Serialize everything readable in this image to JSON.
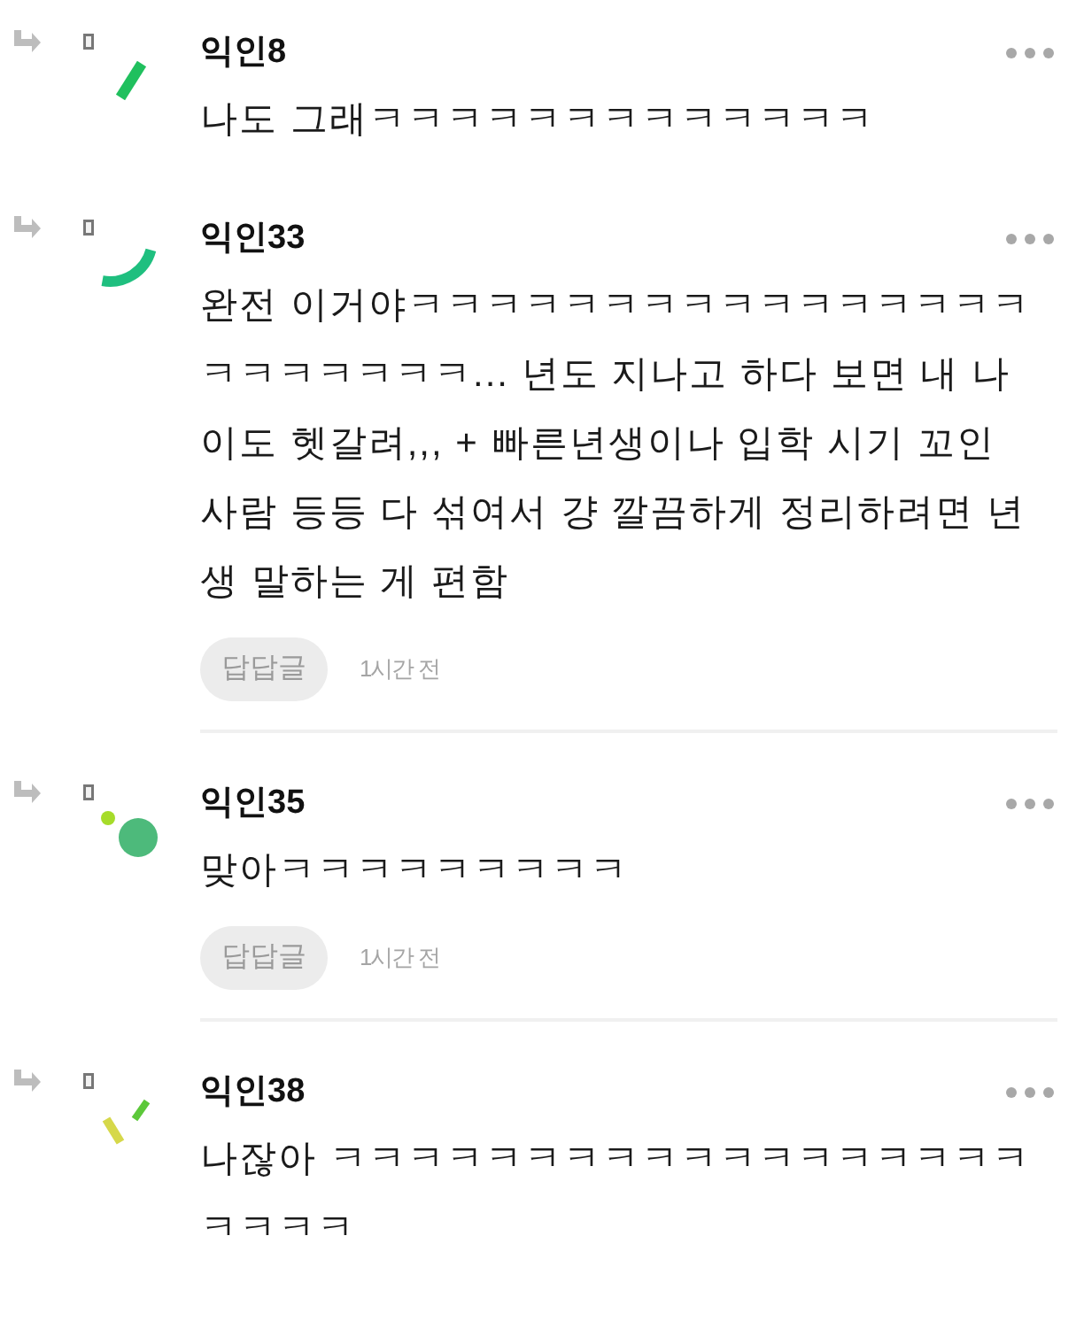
{
  "comments": [
    {
      "author": "익인8",
      "text": "나도 그래ㅋㅋㅋㅋㅋㅋㅋㅋㅋㅋㅋㅋㅋ",
      "avatar": {
        "kind": "bar"
      }
    },
    {
      "author": "익인33",
      "text": "완전 이거야ㅋㅋㅋㅋㅋㅋㅋㅋㅋㅋㅋㅋㅋㅋㅋㅋㅋㅋㅋㅋㅋㅋㅋ... 년도 지나고 하다 보면 내 나이도 헷갈려,,, + 빠른년생이나 입학 시기 꼬인 사람 등등 다 섞여서 걍 깔끔하게 정리하려면 년생 말하는 게 편함",
      "avatar": {
        "kind": "arc"
      },
      "footer": {
        "reply_button": "답답글",
        "time": "1시간 전"
      }
    },
    {
      "author": "익인35",
      "text": "맞아ㅋㅋㅋㅋㅋㅋㅋㅋㅋ",
      "avatar": {
        "kind": "dots"
      },
      "footer": {
        "reply_button": "답답글",
        "time": "1시간 전"
      }
    },
    {
      "author": "익인38",
      "text": "나잖아 ㅋㅋㅋㅋㅋㅋㅋㅋㅋㅋㅋㅋㅋㅋㅋㅋㅋㅋㅋㅋㅋㅋ",
      "avatar": {
        "kind": "dashes"
      }
    }
  ]
}
